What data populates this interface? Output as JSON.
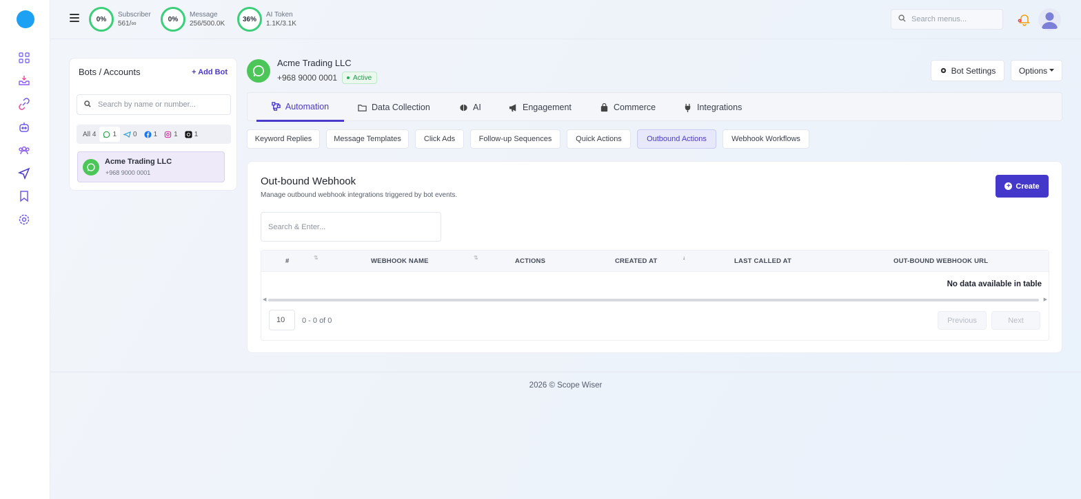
{
  "topbar": {
    "stats": [
      {
        "percent": "0%",
        "label": "Subscriber",
        "value": "561/∞"
      },
      {
        "percent": "0%",
        "label": "Message",
        "value": "256/500.0K"
      },
      {
        "percent": "36%",
        "label": "AI Token",
        "value": "1.1K/3.1K"
      }
    ],
    "search_placeholder": "Search menus..."
  },
  "sidebar": {
    "icons": [
      "dashboard-icon",
      "inbox-icon",
      "link-icon",
      "bot-icon",
      "users-icon",
      "send-icon",
      "bookmark-icon",
      "settings-icon"
    ]
  },
  "bots_panel": {
    "title": "Bots / Accounts",
    "add_label": "+ Add Bot",
    "search_placeholder": "Search by name or number...",
    "filters": [
      {
        "label": "All",
        "count": "4"
      },
      {
        "icon": "whatsapp-icon",
        "count": "1"
      },
      {
        "icon": "telegram-icon",
        "count": "0"
      },
      {
        "icon": "facebook-icon",
        "count": "1"
      },
      {
        "icon": "instagram-icon",
        "count": "1"
      },
      {
        "icon": "threads-icon",
        "count": "1"
      }
    ],
    "items": [
      {
        "name": "Acme Trading LLC",
        "number": "+968 9000 0001"
      }
    ]
  },
  "bot": {
    "name": "Acme Trading LLC",
    "phone": "+968 9000 0001",
    "status": "Active",
    "settings_label": "Bot Settings",
    "options_label": "Options"
  },
  "main_tabs": [
    {
      "label": "Automation",
      "icon": "flow-icon"
    },
    {
      "label": "Data Collection",
      "icon": "folder-icon"
    },
    {
      "label": "AI",
      "icon": "brain-icon"
    },
    {
      "label": "Engagement",
      "icon": "megaphone-icon"
    },
    {
      "label": "Commerce",
      "icon": "bag-icon"
    },
    {
      "label": "Integrations",
      "icon": "plug-icon"
    }
  ],
  "sub_tabs": [
    "Keyword Replies",
    "Message Templates",
    "Click Ads",
    "Follow-up Sequences",
    "Quick Actions",
    "Outbound Actions",
    "Webhook Workflows"
  ],
  "card": {
    "title": "Out-bound Webhook",
    "subtitle": "Manage outbound webhook integrations triggered by bot events.",
    "create_label": "Create",
    "search_placeholder": "Search & Enter...",
    "columns": [
      "#",
      "WEBHOOK NAME",
      "ACTIONS",
      "CREATED AT",
      "LAST CALLED AT",
      "OUT-BOUND WEBHOOK URL"
    ],
    "empty_text": "No data available in table",
    "page_size": "10",
    "page_info": "0 - 0 of 0",
    "prev_label": "Previous",
    "next_label": "Next"
  },
  "footer": "2026 © Scope Wiser",
  "colors": {
    "accent": "#4338ca",
    "success": "#3ccf7a",
    "whatsapp": "#4cc659"
  }
}
